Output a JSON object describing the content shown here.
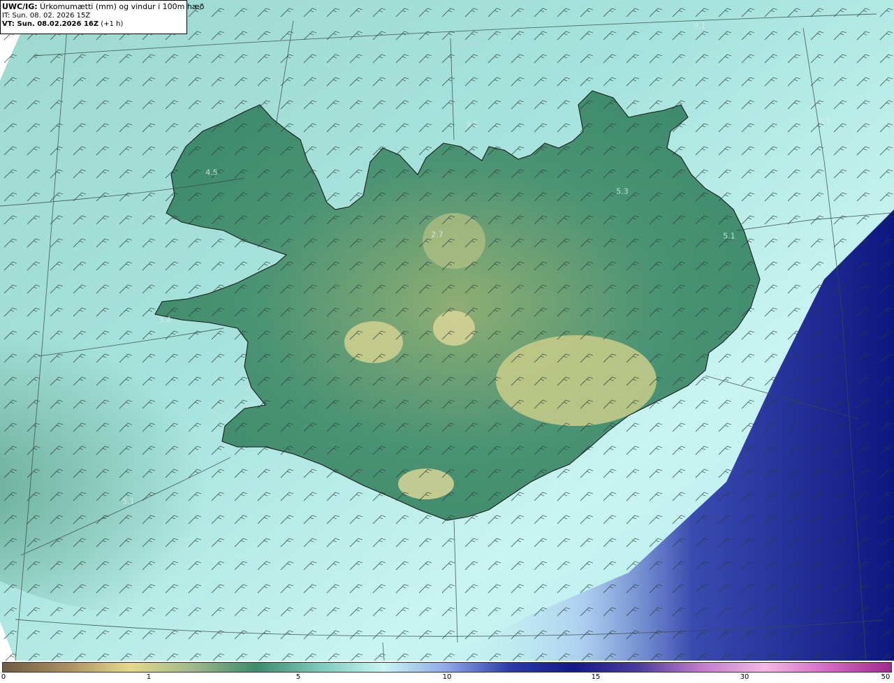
{
  "header": {
    "model": "UWC/IG:",
    "title": " Úrkomumætti (mm) og vindur i 100m hæð",
    "it_line": "IT: Sun. 08. 02. 2026 15Z",
    "vt_bold": "VT: Sun. 08.02.2026 16Z",
    "vt_suffix": " (+1 h)"
  },
  "colors": {
    "ocean_light": "#b8ece8",
    "ocean_mid": "#8fd4cb",
    "land_dark": "#3f8a6e",
    "land_mid": "#5fa583",
    "highland": "#c7cd8a",
    "deep_precip": "#1d2a8e",
    "coast_line": "#1a1a1a"
  },
  "colorbar": {
    "gradient": [
      "#6e5b44",
      "#a98f61",
      "#e5d98c",
      "#9fb78a",
      "#3f8a6e",
      "#7fc9bb",
      "#c9f5f3",
      "#8fa6e6",
      "#2c3aa4",
      "#141a88",
      "#4a3c9c",
      "#c07bc9",
      "#f3b7e3",
      "#d46ac4",
      "#9e2a8e"
    ],
    "ticks": [
      "0",
      "1",
      "5",
      "10",
      "15",
      "30",
      "50"
    ]
  },
  "map_labels": [
    "9.1",
    "2.5",
    "9.5",
    "4.5",
    "5.3",
    "2.7",
    "5.1",
    "3.4",
    "5.1"
  ],
  "wind_barbs": {
    "symbol": "wind-barb"
  }
}
